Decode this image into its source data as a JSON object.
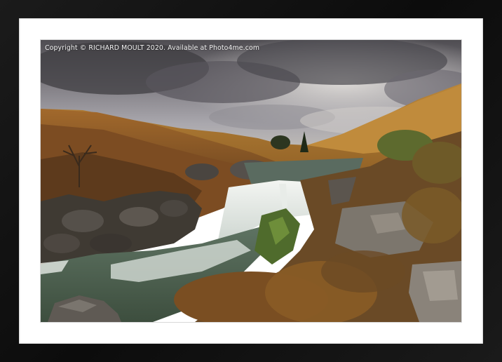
{
  "watermark": {
    "text": "Copyright  © RICHARD MOULT  2020. Available at Photo4me.com"
  },
  "frame": {
    "frame_color": "#111111",
    "mount_color": "#ffffff"
  },
  "photo": {
    "scene": "waterfall-landscape"
  }
}
